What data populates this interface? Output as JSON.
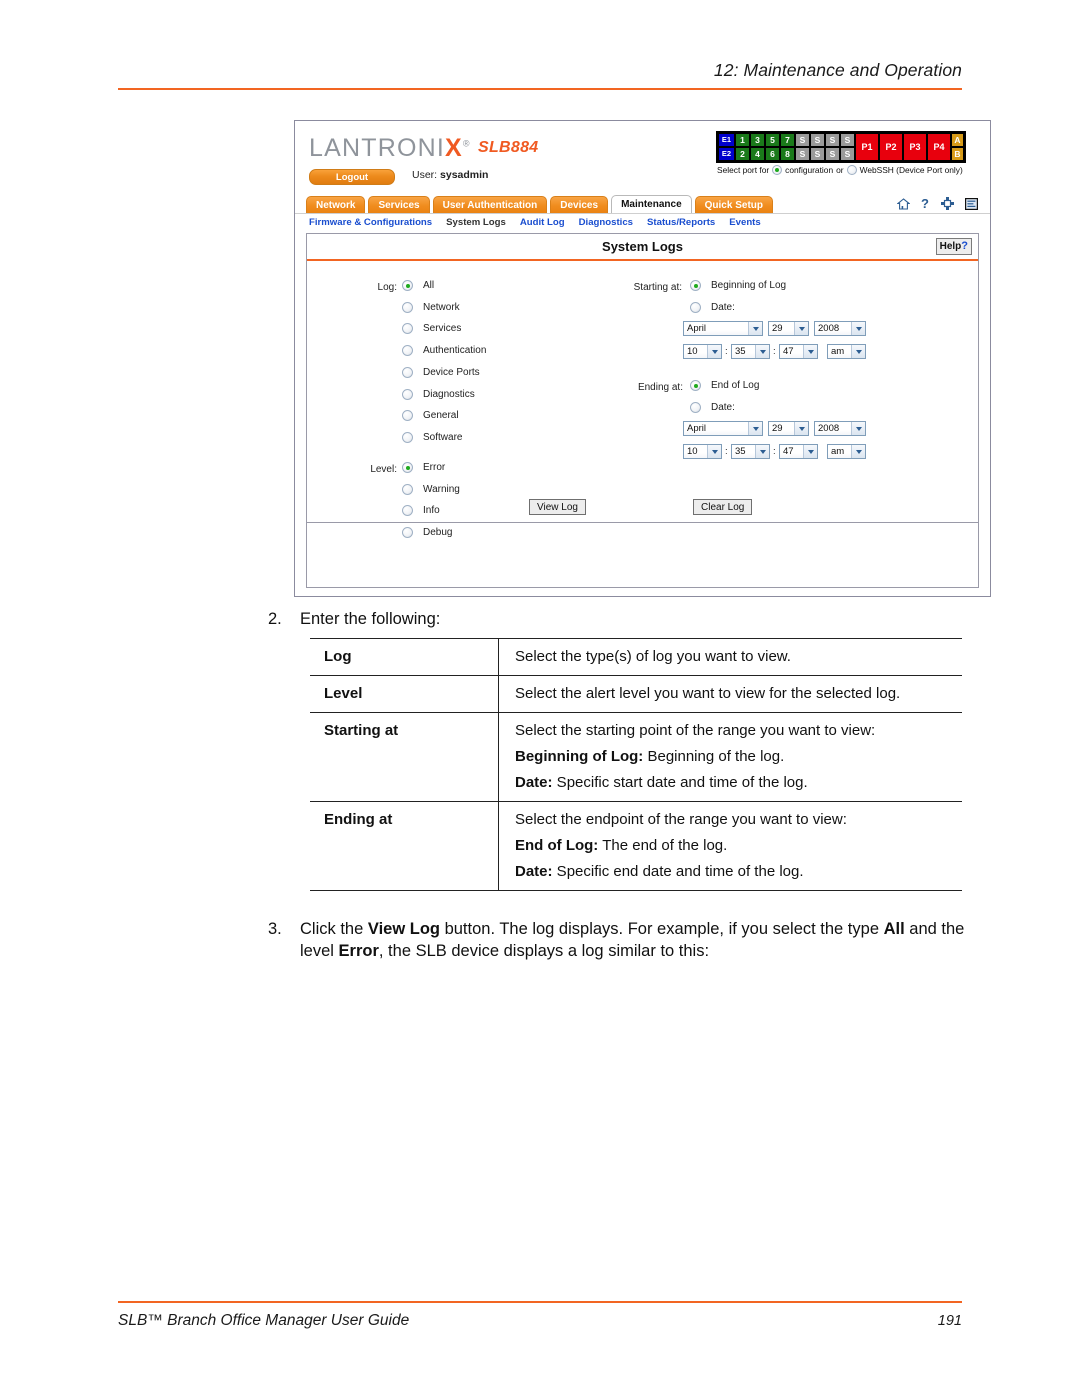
{
  "page": {
    "header_title": "12: Maintenance and Operation",
    "footer_title": "SLB™ Branch Office Manager User Guide",
    "page_number": "191",
    "accent_color": "#F26522"
  },
  "screenshot": {
    "brand": {
      "logo_text_1": "LANTRONI",
      "logo_text_x": "X",
      "logo_reg": "®",
      "model": "SLB884",
      "logout_label": "Logout",
      "user_prefix": "User:",
      "user_name": "sysadmin"
    },
    "portmap": {
      "ethernet": [
        "E1",
        "E2"
      ],
      "device_ports_top": [
        "1",
        "3",
        "5",
        "7"
      ],
      "device_ports_bottom": [
        "2",
        "4",
        "6",
        "8"
      ],
      "serial_top": [
        "S",
        "S",
        "S",
        "S"
      ],
      "serial_bottom": [
        "S",
        "S",
        "S",
        "S"
      ],
      "power_ports": [
        "P1",
        "P2",
        "P3",
        "P4"
      ],
      "ab_ports": [
        "A",
        "B"
      ],
      "select_prefix": "Select port for",
      "option_configuration": "configuration",
      "select_or": "or",
      "option_webssh": "WebSSH (Device Port only)",
      "selected_option": "configuration",
      "colors": {
        "ethernet": "#0000CC",
        "device_port": "#1A7A1A",
        "serial": "#9A9A9A",
        "power": "#E8000D",
        "ab": "#D79B18"
      }
    },
    "tabs": [
      {
        "label": "Network",
        "active": false
      },
      {
        "label": "Services",
        "active": false
      },
      {
        "label": "User Authentication",
        "active": false
      },
      {
        "label": "Devices",
        "active": false
      },
      {
        "label": "Maintenance",
        "active": true
      },
      {
        "label": "Quick Setup",
        "active": false
      }
    ],
    "tool_icons": [
      "home-icon",
      "help-question-icon",
      "connections-icon",
      "list-icon"
    ],
    "subnav": [
      {
        "label": "Firmware & Configurations",
        "active": false
      },
      {
        "label": "System Logs",
        "active": true
      },
      {
        "label": "Audit Log",
        "active": false
      },
      {
        "label": "Diagnostics",
        "active": false
      },
      {
        "label": "Status/Reports",
        "active": false
      },
      {
        "label": "Events",
        "active": false
      }
    ],
    "panel": {
      "title": "System Logs",
      "help_label": "Help",
      "help_mark": "?",
      "log_label": "Log:",
      "log_options": [
        {
          "label": "All",
          "selected": true
        },
        {
          "label": "Network",
          "selected": false
        },
        {
          "label": "Services",
          "selected": false
        },
        {
          "label": "Authentication",
          "selected": false
        },
        {
          "label": "Device Ports",
          "selected": false
        },
        {
          "label": "Diagnostics",
          "selected": false
        },
        {
          "label": "General",
          "selected": false
        },
        {
          "label": "Software",
          "selected": false
        }
      ],
      "level_label": "Level:",
      "level_options": [
        {
          "label": "Error",
          "selected": true
        },
        {
          "label": "Warning",
          "selected": false
        },
        {
          "label": "Info",
          "selected": false
        },
        {
          "label": "Debug",
          "selected": false
        }
      ],
      "starting_label": "Starting at:",
      "starting_options": [
        {
          "label": "Beginning of Log",
          "selected": true
        },
        {
          "label": "Date:",
          "selected": false
        }
      ],
      "starting_date": {
        "month": "April",
        "day": "29",
        "year": "2008",
        "hour": "10",
        "minute": "35",
        "second": "47",
        "meridiem": "am"
      },
      "ending_label": "Ending at:",
      "ending_options": [
        {
          "label": "End of Log",
          "selected": true
        },
        {
          "label": "Date:",
          "selected": false
        }
      ],
      "ending_date": {
        "month": "April",
        "day": "29",
        "year": "2008",
        "hour": "10",
        "minute": "35",
        "second": "47",
        "meridiem": "am"
      },
      "view_log_label": "View Log",
      "clear_log_label": "Clear Log",
      "separator": ":"
    }
  },
  "doc": {
    "step2_num": "2.",
    "step2_text": "Enter the following:",
    "table": [
      {
        "key": "Log",
        "lines": [
          {
            "bold": "",
            "text": "Select the type(s) of log you want to view."
          }
        ]
      },
      {
        "key": "Level",
        "lines": [
          {
            "bold": "",
            "text": "Select the alert level you want to view for the selected log."
          }
        ]
      },
      {
        "key": "Starting at",
        "lines": [
          {
            "bold": "",
            "text": "Select  the starting point of the range you want to view:"
          },
          {
            "bold": "Beginning of Log:",
            "text": " Beginning of the log."
          },
          {
            "bold": "Date:",
            "text": " Specific start date and time of the log."
          }
        ]
      },
      {
        "key": "Ending at",
        "lines": [
          {
            "bold": "",
            "text": "Select the endpoint of the range you want to view:"
          },
          {
            "bold": "End of Log:",
            "text": " The end of the log."
          },
          {
            "bold": "Date:",
            "text": "  Specific end date and time of the log."
          }
        ]
      }
    ],
    "step3_num": "3.",
    "step3_parts": [
      {
        "bold": false,
        "text": "Click the "
      },
      {
        "bold": true,
        "text": "View Log"
      },
      {
        "bold": false,
        "text": " button. The log displays. For example, if you select the type "
      },
      {
        "bold": true,
        "text": "All"
      },
      {
        "bold": false,
        "text": " and the level "
      },
      {
        "bold": true,
        "text": "Error"
      },
      {
        "bold": false,
        "text": ", the SLB device displays a log similar to this:"
      }
    ]
  }
}
